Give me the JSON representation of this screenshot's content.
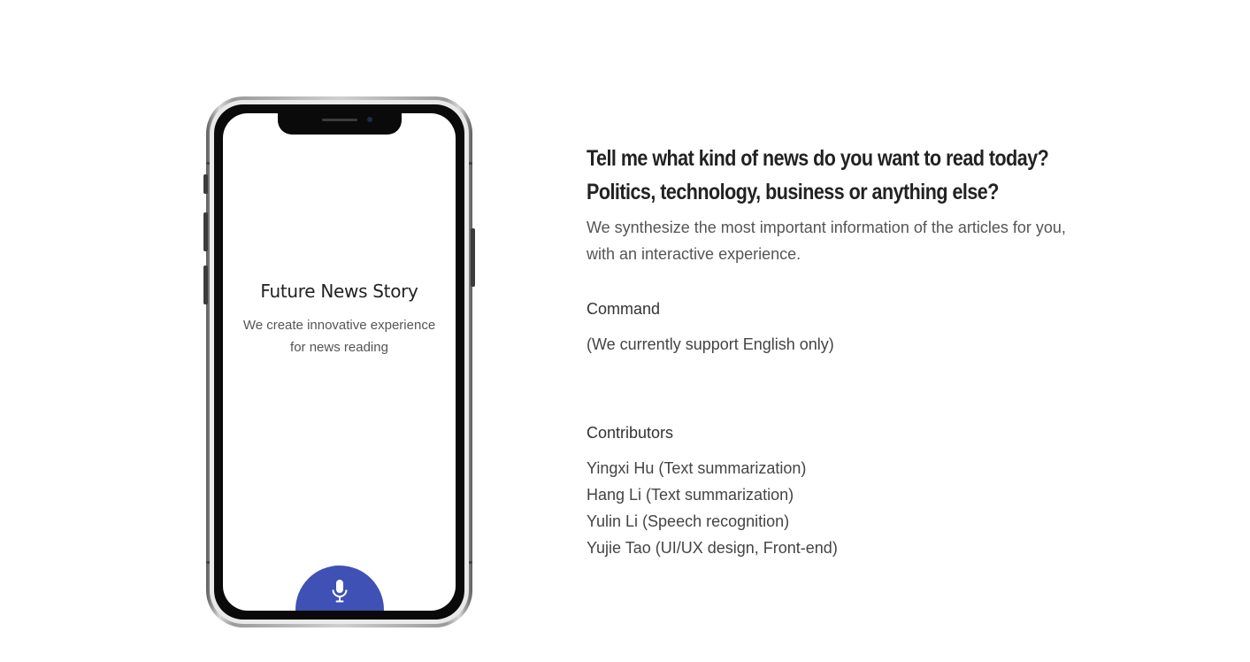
{
  "phone": {
    "screen_title": "Future News Story",
    "screen_subtitle": "We create innovative experience for news reading",
    "mic_button_icon": "microphone-icon",
    "accent_color": "#3f51b5"
  },
  "info": {
    "headline_line1": "Tell me what kind of news do you want to read today?",
    "headline_line2": "Politics, technology, business or anything else?",
    "description_line1": "We synthesize the most important information of the articles for you,",
    "description_line2": "with an interactive experience.",
    "command_title": "Command",
    "command_text": "(We currently support English only)",
    "contributors_title": "Contributors",
    "contributors": [
      "Yingxi Hu (Text summarization)",
      "Hang Li (Text summarization)",
      "Yulin Li (Speech recognition)",
      "Yujie Tao (UI/UX design, Front-end)"
    ]
  }
}
